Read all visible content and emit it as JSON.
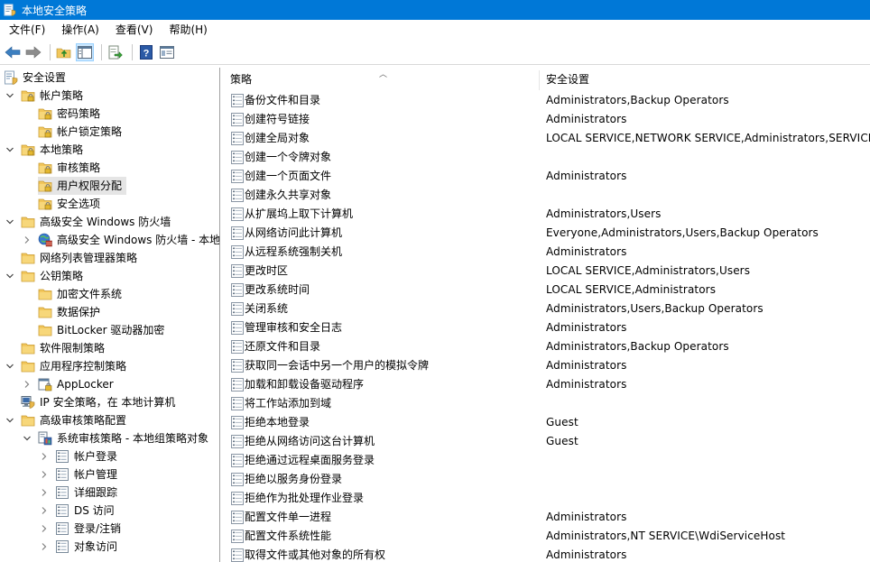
{
  "window": {
    "title": "本地安全策略"
  },
  "menu": [
    {
      "label": "文件(F)"
    },
    {
      "label": "操作(A)"
    },
    {
      "label": "查看(V)"
    },
    {
      "label": "帮助(H)"
    }
  ],
  "toolbar": {
    "buttons": [
      "back-arrow-icon",
      "forward-arrow-icon",
      "up-folder-icon",
      "show-hide-tree-icon",
      "export-list-icon",
      "help-icon",
      "properties-icon"
    ]
  },
  "tree": [
    {
      "label": "安全设置",
      "level": 0,
      "chev": "",
      "icon": "root"
    },
    {
      "label": "帐户策略",
      "level": 1,
      "chev": "down",
      "icon": "folder-lock"
    },
    {
      "label": "密码策略",
      "level": 2,
      "chev": "",
      "icon": "folder-lock"
    },
    {
      "label": "帐户锁定策略",
      "level": 2,
      "chev": "",
      "icon": "folder-lock"
    },
    {
      "label": "本地策略",
      "level": 1,
      "chev": "down",
      "icon": "folder-lock"
    },
    {
      "label": "审核策略",
      "level": 2,
      "chev": "",
      "icon": "folder-lock"
    },
    {
      "label": "用户权限分配",
      "level": 2,
      "chev": "",
      "icon": "folder-lock",
      "selected": true
    },
    {
      "label": "安全选项",
      "level": 2,
      "chev": "",
      "icon": "folder-lock"
    },
    {
      "label": "高级安全 Windows 防火墙",
      "level": 1,
      "chev": "down",
      "icon": "folder"
    },
    {
      "label": "高级安全 Windows 防火墙 - 本地",
      "level": 2,
      "chev": "right",
      "icon": "firewall"
    },
    {
      "label": "网络列表管理器策略",
      "level": 1,
      "chev": "",
      "icon": "folder"
    },
    {
      "label": "公钥策略",
      "level": 1,
      "chev": "down",
      "icon": "folder"
    },
    {
      "label": "加密文件系统",
      "level": 2,
      "chev": "",
      "icon": "folder"
    },
    {
      "label": "数据保护",
      "level": 2,
      "chev": "",
      "icon": "folder"
    },
    {
      "label": "BitLocker 驱动器加密",
      "level": 2,
      "chev": "",
      "icon": "folder"
    },
    {
      "label": "软件限制策略",
      "level": 1,
      "chev": "",
      "icon": "folder"
    },
    {
      "label": "应用程序控制策略",
      "level": 1,
      "chev": "down",
      "icon": "folder"
    },
    {
      "label": "AppLocker",
      "level": 2,
      "chev": "right",
      "icon": "applocker"
    },
    {
      "label": "IP 安全策略，在 本地计算机",
      "level": 1,
      "chev": "",
      "icon": "ipsec"
    },
    {
      "label": "高级审核策略配置",
      "level": 1,
      "chev": "down",
      "icon": "folder"
    },
    {
      "label": "系统审核策略 - 本地组策略对象",
      "level": 2,
      "chev": "down",
      "icon": "audit"
    },
    {
      "label": "帐户登录",
      "level": 3,
      "chev": "right",
      "icon": "audit-item"
    },
    {
      "label": "帐户管理",
      "level": 3,
      "chev": "right",
      "icon": "audit-item"
    },
    {
      "label": "详细跟踪",
      "level": 3,
      "chev": "right",
      "icon": "audit-item"
    },
    {
      "label": "DS 访问",
      "level": 3,
      "chev": "right",
      "icon": "audit-item"
    },
    {
      "label": "登录/注销",
      "level": 3,
      "chev": "right",
      "icon": "audit-item"
    },
    {
      "label": "对象访问",
      "level": 3,
      "chev": "right",
      "icon": "audit-item"
    }
  ],
  "list": {
    "headers": {
      "policy": "策略",
      "setting": "安全设置"
    },
    "rows": [
      {
        "policy": "备份文件和目录",
        "setting": "Administrators,Backup Operators"
      },
      {
        "policy": "创建符号链接",
        "setting": "Administrators"
      },
      {
        "policy": "创建全局对象",
        "setting": "LOCAL SERVICE,NETWORK SERVICE,Administrators,SERVICE"
      },
      {
        "policy": "创建一个令牌对象",
        "setting": ""
      },
      {
        "policy": "创建一个页面文件",
        "setting": "Administrators"
      },
      {
        "policy": "创建永久共享对象",
        "setting": ""
      },
      {
        "policy": "从扩展坞上取下计算机",
        "setting": "Administrators,Users"
      },
      {
        "policy": "从网络访问此计算机",
        "setting": "Everyone,Administrators,Users,Backup Operators"
      },
      {
        "policy": "从远程系统强制关机",
        "setting": "Administrators"
      },
      {
        "policy": "更改时区",
        "setting": "LOCAL SERVICE,Administrators,Users"
      },
      {
        "policy": "更改系统时间",
        "setting": "LOCAL SERVICE,Administrators"
      },
      {
        "policy": "关闭系统",
        "setting": "Administrators,Users,Backup Operators"
      },
      {
        "policy": "管理审核和安全日志",
        "setting": "Administrators"
      },
      {
        "policy": "还原文件和目录",
        "setting": "Administrators,Backup Operators"
      },
      {
        "policy": "获取同一会话中另一个用户的模拟令牌",
        "setting": "Administrators"
      },
      {
        "policy": "加载和卸载设备驱动程序",
        "setting": "Administrators"
      },
      {
        "policy": "将工作站添加到域",
        "setting": ""
      },
      {
        "policy": "拒绝本地登录",
        "setting": "Guest"
      },
      {
        "policy": "拒绝从网络访问这台计算机",
        "setting": "Guest"
      },
      {
        "policy": "拒绝通过远程桌面服务登录",
        "setting": ""
      },
      {
        "policy": "拒绝以服务身份登录",
        "setting": ""
      },
      {
        "policy": "拒绝作为批处理作业登录",
        "setting": ""
      },
      {
        "policy": "配置文件单一进程",
        "setting": "Administrators"
      },
      {
        "policy": "配置文件系统性能",
        "setting": "Administrators,NT SERVICE\\WdiServiceHost"
      },
      {
        "policy": "取得文件或其他对象的所有权",
        "setting": "Administrators"
      }
    ]
  },
  "colors": {
    "titlebar": "#0078d7",
    "selection": "#e5e5e5",
    "folder": "#f2c75c"
  }
}
